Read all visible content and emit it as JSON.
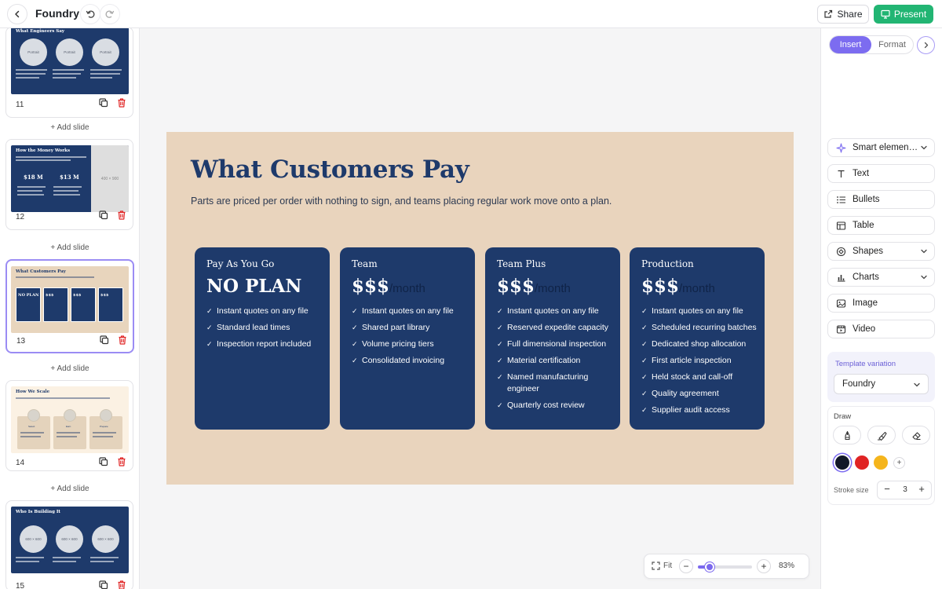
{
  "app": {
    "title": "Foundry"
  },
  "toolbar": {
    "share_label": "Share",
    "present_label": "Present"
  },
  "sidebar": {
    "add_slide_label": "+ Add slide",
    "slides": [
      {
        "number": "11",
        "title": "What Engineers Say",
        "thumb_labels": [
          "Portrait",
          "Portrait",
          "Portrait"
        ]
      },
      {
        "number": "12",
        "title": "How the Money Works",
        "thumb_stats": [
          "$18 M",
          "$13 M",
          "$$$"
        ],
        "thumb_image": "400 × 900"
      },
      {
        "number": "13",
        "title": "What Customers Pay",
        "thumb_plans": [
          "NO PLAN",
          "$$$",
          "$$$",
          "$$$"
        ]
      },
      {
        "number": "14",
        "title": "How We Scale",
        "thumb_cols": [
          "Select",
          "Earn",
          "Prepare"
        ]
      },
      {
        "number": "15",
        "title": "Who Is Building It",
        "thumb_labels": [
          "600 × 600",
          "600 × 600",
          "600 × 600"
        ]
      }
    ]
  },
  "slide": {
    "title": "What Customers Pay",
    "subtitle": "Parts are priced per order with nothing to sign, and teams placing regular work move onto a plan.",
    "plans": [
      {
        "name": "Pay As You Go",
        "price": "NO PLAN",
        "unit": "",
        "features": [
          "Instant quotes on any file",
          "Standard lead times",
          "Inspection report included"
        ]
      },
      {
        "name": "Team",
        "price": "$$$",
        "unit": "/month",
        "features": [
          "Instant quotes on any file",
          "Shared part library",
          "Volume pricing tiers",
          "Consolidated invoicing"
        ]
      },
      {
        "name": "Team Plus",
        "price": "$$$",
        "unit": "/month",
        "features": [
          "Instant quotes on any file",
          "Reserved expedite capacity",
          "Full dimensional inspection",
          "Material certification",
          "Named manufacturing engineer",
          "Quarterly cost review"
        ]
      },
      {
        "name": "Production",
        "price": "$$$",
        "unit": "/month",
        "features": [
          "Instant quotes on any file",
          "Scheduled recurring batches",
          "Dedicated shop allocation",
          "First article inspection",
          "Held stock and call-off",
          "Quality agreement",
          "Supplier audit access"
        ]
      }
    ]
  },
  "zoom": {
    "fit_label": "Fit",
    "value": "83%",
    "level": 0.22
  },
  "panel": {
    "tabs": [
      "Insert",
      "Format"
    ],
    "active_tab": "Insert",
    "insert_items": [
      {
        "label": "Smart elemen…",
        "icon": "sparkle-icon",
        "has_dropdown": true
      },
      {
        "label": "Text",
        "icon": "text-icon",
        "has_dropdown": false
      },
      {
        "label": "Bullets",
        "icon": "list-icon",
        "has_dropdown": false
      },
      {
        "label": "Table",
        "icon": "table-icon",
        "has_dropdown": false
      },
      {
        "label": "Shapes",
        "icon": "shapes-icon",
        "has_dropdown": true
      },
      {
        "label": "Charts",
        "icon": "chart-icon",
        "has_dropdown": true
      },
      {
        "label": "Image",
        "icon": "image-icon",
        "has_dropdown": false
      },
      {
        "label": "Video",
        "icon": "video-icon",
        "has_dropdown": false
      }
    ],
    "template_variation": {
      "label": "Template variation",
      "value": "Foundry"
    },
    "draw": {
      "label": "Draw",
      "tools": [
        "pen-icon",
        "highlighter-icon",
        "eraser-icon"
      ],
      "colors": [
        "#111827",
        "#e02424",
        "#f5b51c"
      ],
      "selected_color": "#111827",
      "stroke_label": "Stroke size",
      "stroke_value": "3"
    }
  },
  "colors": {
    "accent": "#7c6cf0",
    "present": "#22b573",
    "slide_bg": "#e9d4bd",
    "card_bg": "#1e3a6b"
  }
}
